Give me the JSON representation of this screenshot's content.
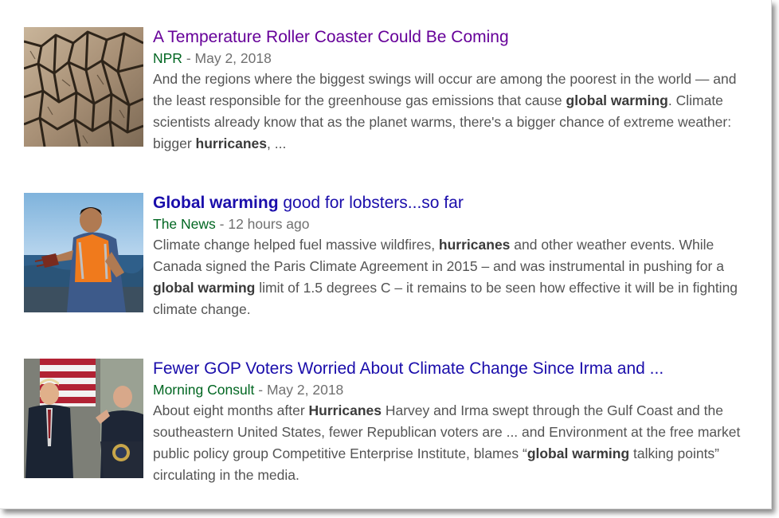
{
  "results": [
    {
      "title": [
        {
          "text": "A Temperature Roller Coaster Could Be Coming",
          "bold": false
        }
      ],
      "visited": true,
      "source": "NPR",
      "separator": " - ",
      "date": "May 2, 2018",
      "thumbnail": "cracked-dry-earth-photo",
      "snippet": [
        {
          "text": "And the regions where the biggest swings will occur are among the poorest in the world — and the least responsible for the greenhouse gas emissions that cause ",
          "bold": false
        },
        {
          "text": "global warming",
          "bold": true
        },
        {
          "text": ". Climate scientists already know that as the planet warms, there's a bigger chance of extreme weather: bigger ",
          "bold": false
        },
        {
          "text": "hurricanes",
          "bold": true
        },
        {
          "text": ", ...",
          "bold": false
        }
      ]
    },
    {
      "title": [
        {
          "text": "Global warming",
          "bold": true
        },
        {
          "text": " good for lobsters...so far",
          "bold": false
        }
      ],
      "visited": false,
      "source": "The News",
      "separator": " - ",
      "date": "12 hours ago",
      "thumbnail": "lobster-fisherman-photo",
      "snippet": [
        {
          "text": "Climate change helped fuel massive wildfires, ",
          "bold": false
        },
        {
          "text": "hurricanes",
          "bold": true
        },
        {
          "text": " and other weather events. While Canada signed the Paris Climate Agreement in 2015 – and was instrumental in pushing for a ",
          "bold": false
        },
        {
          "text": "global warming",
          "bold": true
        },
        {
          "text": " limit of 1.5 degrees C – it remains to be seen how effective it will be in fighting climate change.",
          "bold": false
        }
      ]
    },
    {
      "title": [
        {
          "text": "Fewer GOP Voters Worried About Climate Change Since Irma and ...",
          "bold": false
        }
      ],
      "visited": false,
      "source": "Morning Consult",
      "separator": " - ",
      "date": "May 2, 2018",
      "thumbnail": "press-conference-podium-photo",
      "snippet": [
        {
          "text": "About eight months after ",
          "bold": false
        },
        {
          "text": "Hurricanes",
          "bold": true
        },
        {
          "text": " Harvey and Irma swept through the Gulf Coast and the southeastern United States, fewer Republican voters are ... and Environment at the free market public policy group Competitive Enterprise Institute, blames “",
          "bold": false
        },
        {
          "text": "global warming",
          "bold": true
        },
        {
          "text": " talking points” circulating in the media.",
          "bold": false
        }
      ]
    }
  ],
  "colors": {
    "title_link": "#1a0dab",
    "title_visited": "#660099",
    "source": "#006621",
    "meta": "#707070",
    "snippet": "#545454"
  }
}
